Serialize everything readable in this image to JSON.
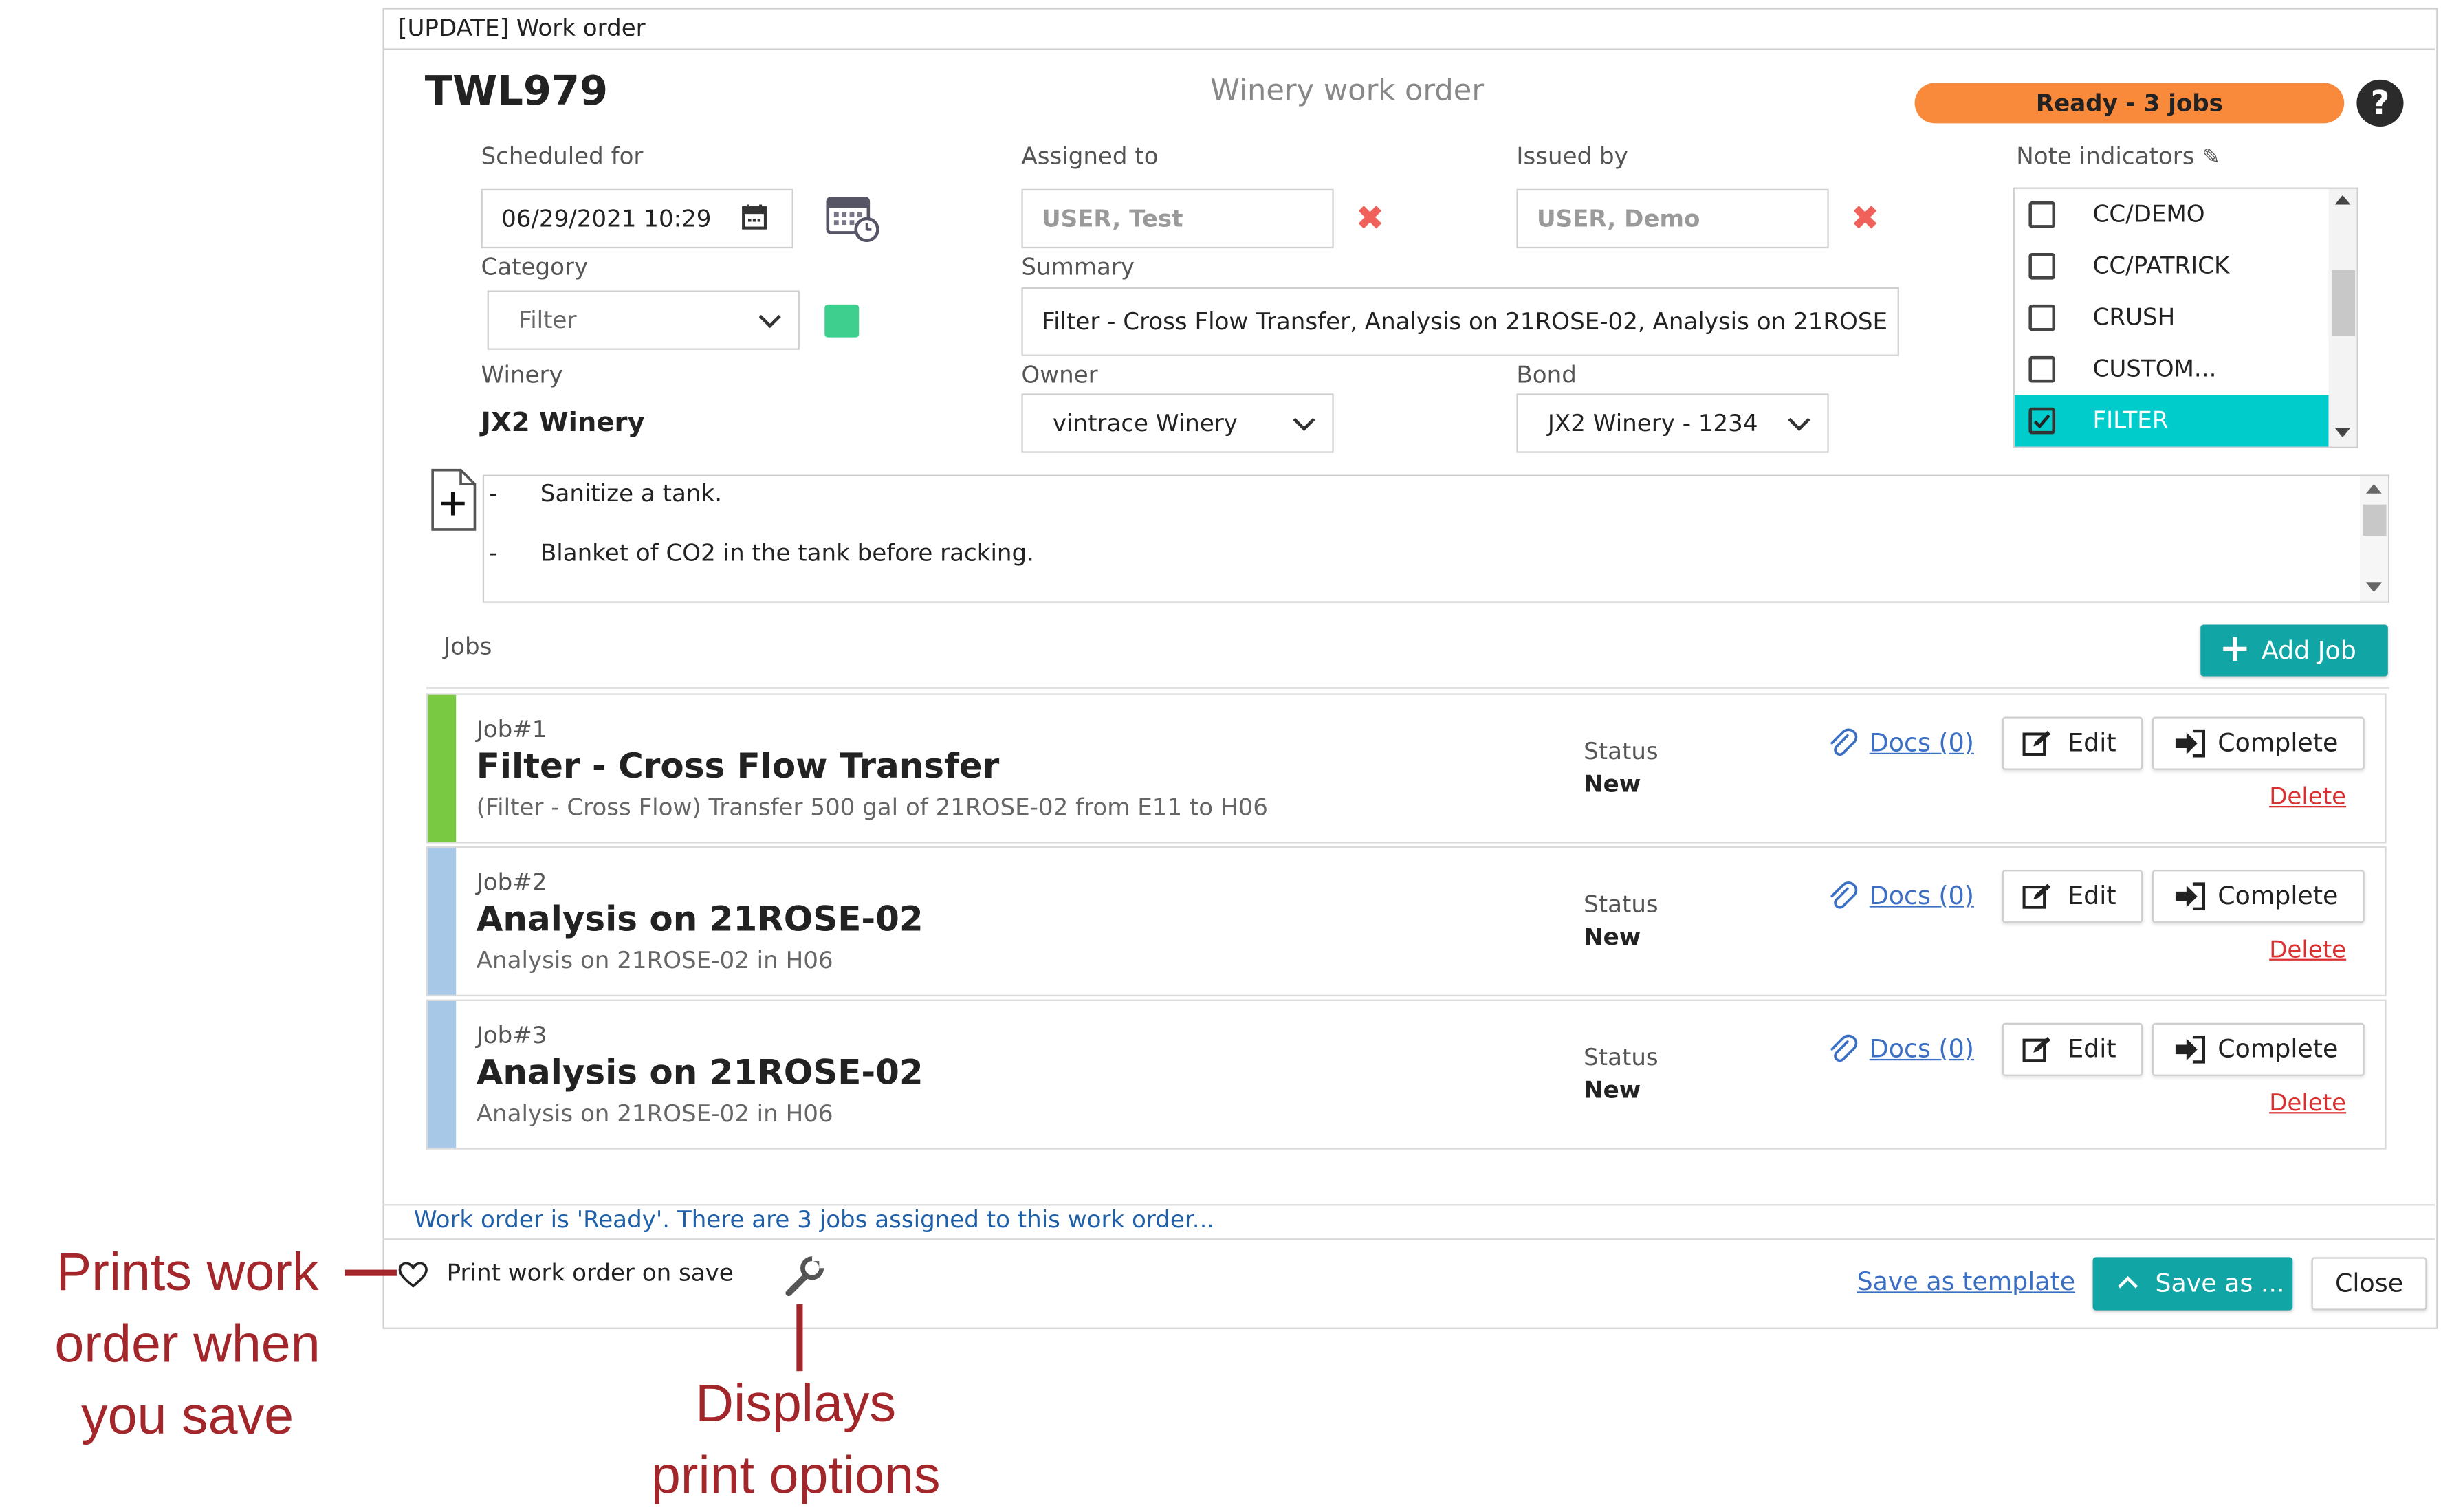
{
  "window": {
    "title": "[UPDATE] Work order"
  },
  "header": {
    "wo_code": "TWL979",
    "subtitle": "Winery work order",
    "status_badge": "Ready - 3 jobs",
    "help_icon": "question-circle-icon"
  },
  "fields": {
    "scheduled_label": "Scheduled for",
    "scheduled_value": "06/29/2021 10:29",
    "assigned_label": "Assigned to",
    "assigned_value": "USER, Test",
    "issued_label": "Issued by",
    "issued_value": "USER, Demo",
    "category_label": "Category",
    "category_value": "Filter",
    "category_color": "#3ecf8e",
    "summary_label": "Summary",
    "summary_value": "Filter - Cross Flow Transfer, Analysis on 21ROSE-02, Analysis on 21ROSE",
    "winery_label": "Winery",
    "winery_value": "JX2 Winery",
    "owner_label": "Owner",
    "owner_value": "vintrace Winery",
    "bond_label": "Bond",
    "bond_value": "JX2 Winery - 1234"
  },
  "note_indicators": {
    "label": "Note indicators",
    "items": [
      {
        "label": "CC/DEMO",
        "checked": false
      },
      {
        "label": "CC/PATRICK",
        "checked": false
      },
      {
        "label": "CRUSH",
        "checked": false
      },
      {
        "label": "CUSTOM...",
        "checked": false
      },
      {
        "label": "FILTER",
        "checked": true
      }
    ]
  },
  "notes": {
    "lines": [
      {
        "bullet": "-",
        "text": "Sanitize a tank."
      },
      {
        "bullet": "-",
        "text": "Blanket of CO2 in the tank before racking."
      }
    ]
  },
  "jobs_section": {
    "label": "Jobs",
    "add_button": "Add Job"
  },
  "jobs": [
    {
      "number": "Job#1",
      "title": "Filter - Cross Flow Transfer",
      "desc": "(Filter - Cross Flow) Transfer 500 gal of 21ROSE-02 from E11 to H06",
      "status_label": "Status",
      "status": "New",
      "docs": "Docs (0)",
      "edit": "Edit",
      "complete": "Complete",
      "delete": "Delete",
      "color": "#7ac943"
    },
    {
      "number": "Job#2",
      "title": "Analysis on 21ROSE-02",
      "desc": "Analysis on 21ROSE-02 in H06",
      "status_label": "Status",
      "status": "New",
      "docs": "Docs (0)",
      "edit": "Edit",
      "complete": "Complete",
      "delete": "Delete",
      "color": "#a8c8e8"
    },
    {
      "number": "Job#3",
      "title": "Analysis on 21ROSE-02",
      "desc": "Analysis on 21ROSE-02 in H06",
      "status_label": "Status",
      "status": "New",
      "docs": "Docs (0)",
      "edit": "Edit",
      "complete": "Complete",
      "delete": "Delete",
      "color": "#a8c8e8"
    }
  ],
  "footer": {
    "message": "Work order is 'Ready'. There are 3 jobs assigned to this work order...",
    "print_label": "Print work order on save",
    "save_template": "Save as template",
    "save_as": "Save as ...",
    "close": "Close"
  },
  "annotations": {
    "print_note": [
      "Prints work",
      "order when",
      "you save"
    ],
    "options_note": [
      "Displays",
      "print options"
    ]
  },
  "colors": {
    "accent": "#12a5a5",
    "badge": "#f98a3c",
    "annotation": "#a3262a",
    "selected": "#00cccc"
  }
}
